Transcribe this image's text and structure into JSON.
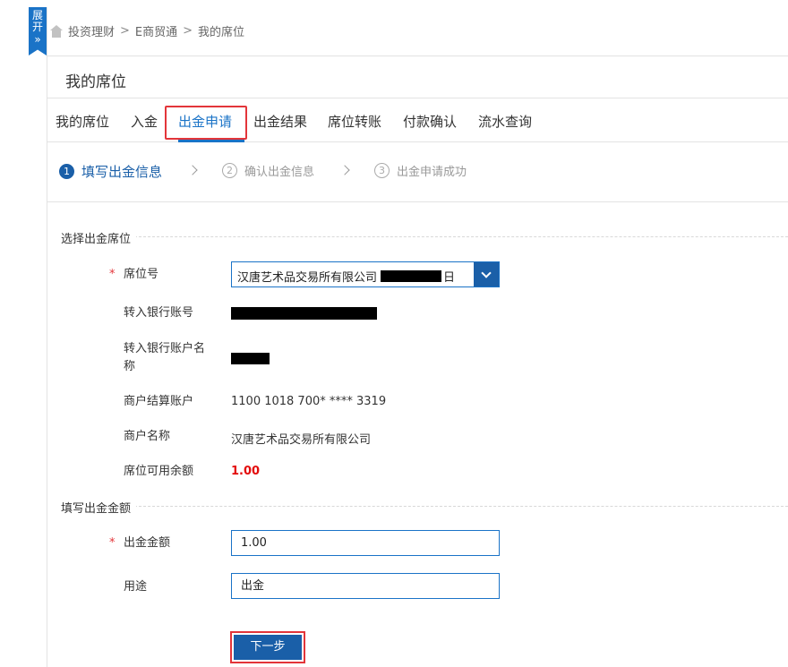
{
  "sidebar_toggle": {
    "label_line1": "展",
    "label_line2": "开",
    "arrow": "»"
  },
  "breadcrumb": {
    "items": [
      "投资理财",
      "E商贸通",
      "我的席位"
    ],
    "separator": ">"
  },
  "page_title": "我的席位",
  "tabs": [
    {
      "label": "我的席位",
      "active": false
    },
    {
      "label": "入金",
      "active": false
    },
    {
      "label": "出金申请",
      "active": true
    },
    {
      "label": "出金结果",
      "active": false
    },
    {
      "label": "席位转账",
      "active": false
    },
    {
      "label": "付款确认",
      "active": false
    },
    {
      "label": "流水查询",
      "active": false
    }
  ],
  "steps": [
    {
      "number": "1",
      "label": "填写出金信息",
      "active": true
    },
    {
      "number": "2",
      "label": "确认出金信息",
      "active": false
    },
    {
      "number": "3",
      "label": "出金申请成功",
      "active": false
    }
  ],
  "section_seat": {
    "legend": "选择出金席位",
    "seat_label": "席位号",
    "seat_value_prefix": "汉唐艺术品交易所有限公司",
    "seat_value_suffix": "日",
    "bank_account_label": "转入银行账号",
    "bank_name_label_line1": "转入银行账户名",
    "bank_name_label_line2": "称",
    "settlement_label": "商户结算账户",
    "settlement_value": "1100 1018 700* **** 3319",
    "merchant_label": "商户名称",
    "merchant_value": "汉唐艺术品交易所有限公司",
    "balance_label": "席位可用余额",
    "balance_value": "1.00"
  },
  "section_amount": {
    "legend": "填写出金金额",
    "amount_label": "出金金额",
    "amount_value": "1.00",
    "purpose_label": "用途",
    "purpose_value": "出金"
  },
  "required_mark": "*",
  "next_button": "下一步",
  "colors": {
    "accent": "#1a5fa8",
    "highlight": "#e3353a",
    "balance": "#e30b0b"
  }
}
